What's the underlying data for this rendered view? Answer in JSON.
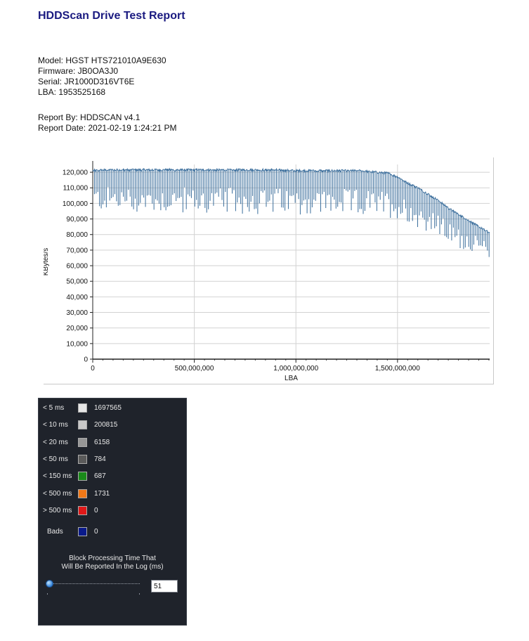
{
  "report": {
    "title": "HDDScan Drive Test Report",
    "model": "Model: HGST HTS721010A9E630",
    "firmware": "Firmware: JB0OA3J0",
    "serial": "Serial: JR1000D316VT6E",
    "lba": "LBA: 1953525168",
    "report_by": "Report By: HDDSCAN v4.1",
    "report_date": "Report Date: 2021-02-19 1:24:21 PM"
  },
  "chart_data": {
    "type": "line",
    "title": "",
    "xlabel": "LBA",
    "ylabel": "KBytes/s",
    "xlim": [
      0,
      1953525168
    ],
    "ylim": [
      0,
      125000
    ],
    "xticks": [
      0,
      500000000,
      1000000000,
      1500000000
    ],
    "xtick_labels": [
      "0",
      "500,000,000",
      "1,000,000,000",
      "1,500,000,000"
    ],
    "yticks": [
      0,
      10000,
      20000,
      30000,
      40000,
      50000,
      60000,
      70000,
      80000,
      90000,
      100000,
      110000,
      120000
    ],
    "ytick_labels": [
      "0",
      "10,000",
      "20,000",
      "30,000",
      "40,000",
      "50,000",
      "60,000",
      "70,000",
      "80,000",
      "90,000",
      "100,000",
      "110,000",
      "120,000"
    ],
    "grid": true,
    "line_color": "#3b6e9c",
    "x": [
      0,
      100000000,
      200000000,
      300000000,
      400000000,
      500000000,
      600000000,
      700000000,
      800000000,
      900000000,
      1000000000,
      1100000000,
      1200000000,
      1300000000,
      1400000000,
      1450000000,
      1500000000,
      1550000000,
      1600000000,
      1650000000,
      1700000000,
      1750000000,
      1800000000,
      1850000000,
      1900000000,
      1953525168
    ],
    "y": [
      121000,
      121500,
      121500,
      121500,
      121500,
      121500,
      121500,
      121500,
      121500,
      121500,
      121000,
      121000,
      121000,
      121000,
      120000,
      119500,
      117000,
      113000,
      110000,
      106000,
      102000,
      97000,
      93000,
      89000,
      85000,
      81000
    ],
    "min_y": [
      95000,
      95000,
      93000,
      94000,
      94000,
      93000,
      93000,
      93000,
      93000,
      92000,
      93000,
      92000,
      92000,
      92000,
      91000,
      91000,
      90000,
      88000,
      84000,
      82000,
      79000,
      75000,
      71000,
      70000,
      68000,
      65000
    ],
    "series": [
      {
        "values": [
          121000,
          121500,
          121500,
          121500,
          121500,
          121500,
          121500,
          121500,
          121500,
          121500,
          121000,
          121000,
          121000,
          121000,
          120000,
          119500,
          117000,
          113000,
          110000,
          106000,
          102000,
          97000,
          93000,
          89000,
          85000,
          81000
        ]
      }
    ]
  },
  "legend": {
    "items": [
      {
        "label": "< 5 ms",
        "color": "#e6e6e6",
        "count": "1697565"
      },
      {
        "label": "< 10 ms",
        "color": "#c8c8c8",
        "count": "200815"
      },
      {
        "label": "< 20 ms",
        "color": "#969696",
        "count": "6158"
      },
      {
        "label": "< 50 ms",
        "color": "#5a5a5a",
        "count": "784"
      },
      {
        "label": "< 150 ms",
        "color": "#1a8a1a",
        "count": "687"
      },
      {
        "label": "< 500 ms",
        "color": "#f07818",
        "count": "1731"
      },
      {
        "label": "> 500 ms",
        "color": "#e01818",
        "count": "0"
      }
    ],
    "bads": {
      "label": "Bads",
      "color": "#0a1a8a",
      "count": "0"
    },
    "caption_line1": "Block Processing Time That",
    "caption_line2": "Will Be Reported In the Log (ms)",
    "threshold_value": "51"
  }
}
